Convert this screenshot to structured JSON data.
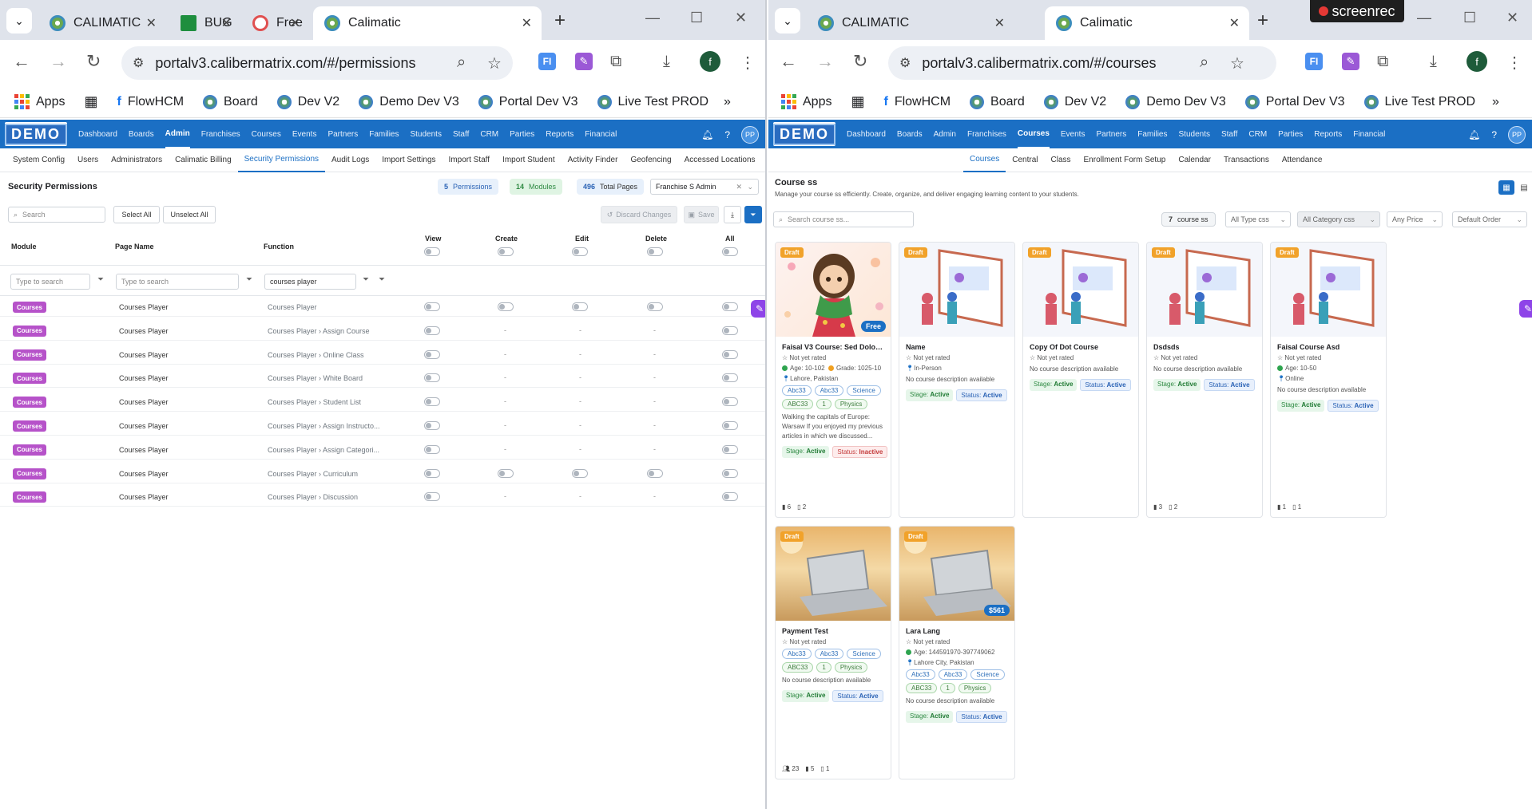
{
  "left": {
    "tab_menu": "⌄",
    "tabs": [
      {
        "label": "CALIMATIC"
      },
      {
        "label": "BUG"
      },
      {
        "label": "Free"
      },
      {
        "label": "Calimatic"
      }
    ],
    "url": "portalv3.calibermatrix.com/#/permissions",
    "bookmarks": [
      "Apps",
      "FlowHCM",
      "Board",
      "Dev V2",
      "Demo Dev V3",
      "Portal Dev V3",
      "Live Test PROD"
    ],
    "nav": [
      "Dashboard",
      "Boards",
      "Admin",
      "Franchises",
      "Courses",
      "Events",
      "Partners",
      "Families",
      "Students",
      "Staff",
      "CRM",
      "Parties",
      "Reports",
      "Financial"
    ],
    "subnav": [
      "System Config",
      "Users",
      "Administrators",
      "Calimatic Billing",
      "Security Permissions",
      "Audit Logs",
      "Import Settings",
      "Import Staff",
      "Import Student",
      "Activity Finder",
      "Geofencing",
      "Accessed Locations"
    ],
    "page_title": "Security Permissions",
    "permissions_count": "5",
    "permissions_label": "Permissions",
    "modules_count": "14",
    "modules_label": "Modules",
    "pages_count": "496",
    "pages_label": "Total Pages",
    "role": "Franchise S Admin",
    "search_placeholder": "Search",
    "select_all": "Select All",
    "unselect_all": "Unselect All",
    "discard": "Discard Changes",
    "save": "Save",
    "columns": {
      "module": "Module",
      "page": "Page Name",
      "function": "Function",
      "view": "View",
      "create": "Create",
      "edit": "Edit",
      "delete": "Delete",
      "all": "All"
    },
    "filter_placeholder": "Type to search",
    "function_filter": "courses player",
    "dash": "-",
    "rows": [
      {
        "module": "Courses",
        "page": "Courses Player",
        "function": "Courses Player"
      },
      {
        "module": "Courses",
        "page": "Courses Player",
        "function": "Courses Player › Assign Course"
      },
      {
        "module": "Courses",
        "page": "Courses Player",
        "function": "Courses Player › Online Class"
      },
      {
        "module": "Courses",
        "page": "Courses Player",
        "function": "Courses Player › White Board"
      },
      {
        "module": "Courses",
        "page": "Courses Player",
        "function": "Courses Player › Student List"
      },
      {
        "module": "Courses",
        "page": "Courses Player",
        "function": "Courses Player › Assign Instructo..."
      },
      {
        "module": "Courses",
        "page": "Courses Player",
        "function": "Courses Player › Assign Categori..."
      },
      {
        "module": "Courses",
        "page": "Courses Player",
        "function": "Courses Player › Curriculum"
      },
      {
        "module": "Courses",
        "page": "Courses Player",
        "function": "Courses Player › Discussion"
      }
    ]
  },
  "right": {
    "tabs": [
      {
        "label": "CALIMATIC"
      },
      {
        "label": "Calimatic"
      }
    ],
    "screenrec": "screenrec",
    "url": "portalv3.calibermatrix.com/#/courses",
    "subnav": [
      "Courses",
      "Central",
      "Class",
      "Enrollment Form Setup",
      "Calendar",
      "Transactions",
      "Attendance"
    ],
    "title": "Course ss",
    "subtitle": "Manage your course ss efficiently. Create, organize, and deliver engaging learning content to your students.",
    "search_placeholder": "Search course ss...",
    "count_num": "7",
    "count_label": "course ss",
    "filters": [
      "All Type css",
      "All Category css",
      "Any Price",
      "Default Order"
    ],
    "cards": [
      {
        "title": "Faisal V3 Course: Sed Dolore Con...",
        "draft": "Draft",
        "price": "Free",
        "rating": "Not yet rated",
        "age": "Age: 10-102",
        "grade": "Grade: 1025-10",
        "location": "Lahore, Pakistan",
        "tags": [
          "Abc33",
          "Abc33",
          "Science",
          "ABC33",
          "1",
          "Physics"
        ],
        "desc": "Walking the capitals of Europe: Warsaw If you enjoyed my previous articles in which we discussed...",
        "stage": "Active",
        "status": "Inactive",
        "foot1": "6",
        "foot2": "2"
      },
      {
        "title": "Name",
        "draft": "Draft",
        "rating": "Not yet rated",
        "location": "In-Person",
        "desc": "No course description available",
        "stage": "Active",
        "status": "Active"
      },
      {
        "title": "Copy Of Dot Course",
        "draft": "Draft",
        "rating": "Not yet rated",
        "desc": "No course description available",
        "stage": "Active",
        "status": "Active"
      },
      {
        "title": "Dsdsds",
        "draft": "Draft",
        "rating": "Not yet rated",
        "desc": "No course description available",
        "stage": "Active",
        "status": "Active",
        "foot1": "3",
        "foot2": "2"
      },
      {
        "title": "Faisal Course Asd",
        "draft": "Draft",
        "rating": "Not yet rated",
        "age": "Age: 10-50",
        "location": "Online",
        "desc": "No course description available",
        "stage": "Active",
        "status": "Active",
        "foot1": "1",
        "foot2": "1"
      },
      {
        "title": "Payment Test",
        "draft": "Draft",
        "rating": "Not yet rated",
        "tags": [
          "Abc33",
          "Abc33",
          "Science",
          "ABC33",
          "1",
          "Physics"
        ],
        "desc": "No course description available",
        "stage": "Active",
        "status": "Active",
        "foot0": "23",
        "foot1": "5",
        "foot2": "1"
      },
      {
        "title": "Lara Lang",
        "draft": "Draft",
        "price": "$561",
        "rating": "Not yet rated",
        "age": "Age: 144591970-397749062",
        "location": "Lahore City, Pakistan",
        "tags": [
          "Abc33",
          "Abc33",
          "Science",
          "ABC33",
          "1",
          "Physics"
        ],
        "desc": "No course description available",
        "stage": "Active",
        "status": "Active"
      }
    ],
    "stage_label": "Stage:",
    "status_label": "Status:"
  },
  "profile_initial": "f",
  "avatar": "PP",
  "colors": {
    "brand": "#1b6fc4",
    "badge": "#b652c9",
    "draft": "#f1a22a"
  }
}
